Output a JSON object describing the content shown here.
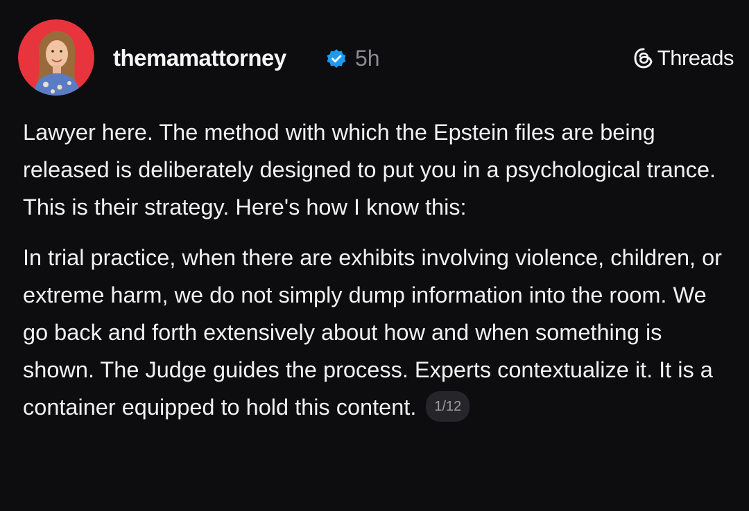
{
  "post": {
    "author": {
      "username": "themamattorney",
      "verified": true,
      "avatar_icon": "profile-photo"
    },
    "time_ago": "5h",
    "source": {
      "label": "Threads",
      "icon": "threads-logo-icon"
    },
    "paragraphs": [
      "Lawyer here. The method with which the Epstein files are being released is deliberately designed to put you in a psychological trance. This is their strategy. Here's how I know this:",
      "In trial practice, when there are exhibits involving violence, children, or extreme harm, we do not simply dump information into the room. We go back and forth extensively about how and when something is shown. The Judge guides the process. Experts contextualize it. It is a container equipped to hold this content."
    ],
    "page_indicator": "1/12"
  },
  "colors": {
    "background": "#0d0d0f",
    "text": "#f1f1f1",
    "muted": "#8b8b90",
    "verified_badge": "#1d9bf0",
    "avatar_ring": "#e8343c"
  }
}
